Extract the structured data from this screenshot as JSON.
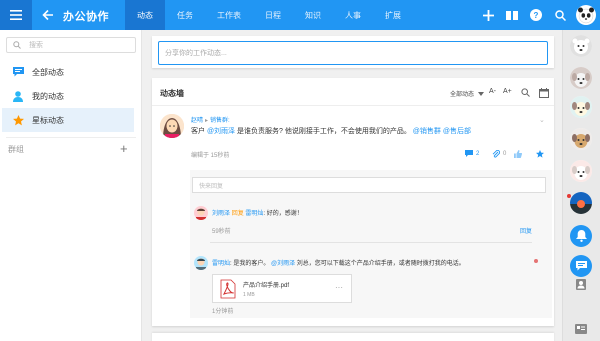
{
  "header": {
    "title": "办公协作",
    "tabs": [
      {
        "label": "动态",
        "active": true
      },
      {
        "label": "任务"
      },
      {
        "label": "工作表"
      },
      {
        "label": "日程"
      },
      {
        "label": "知识"
      },
      {
        "label": "人事"
      },
      {
        "label": "扩展"
      }
    ],
    "accent_color": "#2196f3",
    "dark_accent": "#1976d2",
    "icons": [
      "menu-icon",
      "back-arrow-icon",
      "plus-icon",
      "book-icon",
      "help-icon",
      "search-icon",
      "panda-avatar"
    ]
  },
  "sidebar": {
    "search_placeholder": "搜索",
    "items": [
      {
        "label": "全部动态",
        "icon": "message-icon",
        "color": "#2196f3"
      },
      {
        "label": "我的动态",
        "icon": "person-icon",
        "color": "#29b6f6"
      },
      {
        "label": "星标动态",
        "icon": "star-icon",
        "color": "#ff9800",
        "active": true
      }
    ],
    "group_label": "群组",
    "group_add": "+"
  },
  "share": {
    "placeholder": "分享你的工作动态..."
  },
  "feed": {
    "title": "动态墙",
    "filter": "全部动态",
    "font_smaller": "A-",
    "font_larger": "A+",
    "post": {
      "author": "赵晴",
      "target": "销售群:",
      "text_prefix": "客户 ",
      "mention1": "@刘雨泽",
      "text_mid": " 是谁负责服务? 他说刚接手工作，不会使用我们的产品。 ",
      "mention2": "@销售群",
      "mention3": "@售后部",
      "time": "编辑于 15秒前",
      "comment_count": "2",
      "attach_count": "0"
    },
    "reply_placeholder": "快来回复",
    "comments": [
      {
        "author": "刘雨泽",
        "verb": "回复",
        "to": "雷明灿",
        "text": ": 好的，感谢！",
        "time": "59秒前",
        "reply_label": "回复"
      },
      {
        "author": "雷明灿",
        "text_prefix": ": 是我的客户。",
        "mention": "@刘雨泽",
        "text_suffix": " 刘总，您可以下载这个产品介绍手册，或者随时拨打我的电话。",
        "time": "1分钟前",
        "attachment": {
          "name": "产品介绍手册.pdf",
          "size": "1 MB",
          "more": "···"
        }
      }
    ]
  },
  "rail": {
    "icons": [
      "bear-avatar",
      "dog-avatar",
      "dog-avatar-2",
      "dog-avatar-3",
      "dog-avatar-4",
      "sunset-avatar",
      "bell-icon",
      "message-icon",
      "contact-icon",
      "card-icon"
    ]
  }
}
